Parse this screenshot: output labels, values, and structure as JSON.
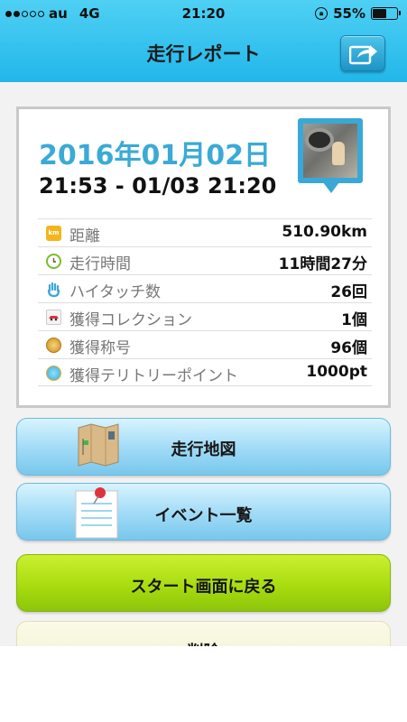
{
  "status_bar": {
    "carrier": "au",
    "network": "4G",
    "time": "21:20",
    "battery": "55%",
    "battery_level": 0.55,
    "signal_bars_filled": 2,
    "signal_bars_total": 5
  },
  "nav": {
    "title": "走行レポート",
    "share_icon": "share-icon"
  },
  "report": {
    "date": "2016年01月02日",
    "time_range": "21:53 - 01/03 21:20",
    "stats": [
      {
        "icon": "distance-icon",
        "label": "距離",
        "value": "510.90km"
      },
      {
        "icon": "clock-icon",
        "label": "走行時間",
        "value": "11時間27分"
      },
      {
        "icon": "hand-icon",
        "label": "ハイタッチ数",
        "value": "26回"
      },
      {
        "icon": "car-collection-icon",
        "label": "獲得コレクション",
        "value": "1個"
      },
      {
        "icon": "medal-icon",
        "label": "獲得称号",
        "value": "96個"
      },
      {
        "icon": "territory-point-icon",
        "label": "獲得テリトリーポイント",
        "value": "1000pt"
      }
    ],
    "distance_icon_text": "km"
  },
  "buttons": {
    "route_map": "走行地図",
    "event_list": "イベント一覧",
    "back_to_start": "スタート画面に戻る",
    "delete": "削除"
  },
  "colors": {
    "header": "#22b7ea",
    "date_text": "#3aaad6",
    "green_button": "#a6da0e"
  }
}
